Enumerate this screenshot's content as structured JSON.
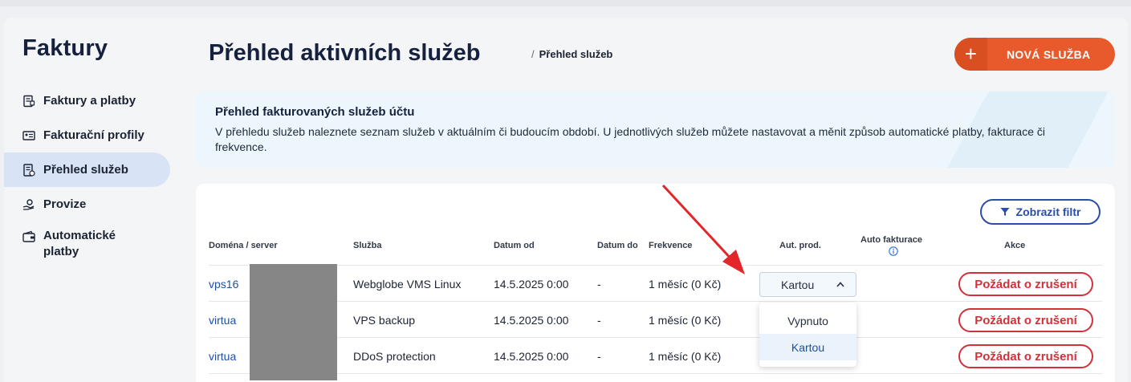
{
  "sidebar": {
    "title": "Faktury",
    "items": [
      {
        "label": "Faktury a platby",
        "icon": "invoice-icon"
      },
      {
        "label": "Fakturační profily",
        "icon": "profile-card-icon"
      },
      {
        "label": "Přehled služeb",
        "icon": "services-doc-icon"
      },
      {
        "label": "Provize",
        "icon": "hand-coin-icon"
      },
      {
        "label": "Automatické platby",
        "icon": "wallet-icon"
      }
    ],
    "active_index": 2
  },
  "header": {
    "title": "Přehled aktivních služeb",
    "breadcrumb_sep": "/",
    "breadcrumb": "Přehled služeb",
    "new_button": "NOVÁ SLUŽBA"
  },
  "info": {
    "title": "Přehled fakturovaných služeb účtu",
    "text": "V přehledu služeb naleznete seznam služeb v aktuálním či budoucím období. U jednotlivých služeb můžete nastavovat a měnit způsob automatické platby, fakturace či frekvence."
  },
  "table": {
    "filter_button": "Zobrazit filtr",
    "headers": {
      "domain": "Doména / server",
      "service": "Služba",
      "date_from": "Datum od",
      "date_to": "Datum do",
      "frequency": "Frekvence",
      "auto_renew": "Aut. prod.",
      "auto_invoice": "Auto fakturace",
      "actions": "Akce"
    },
    "rows": [
      {
        "domain": "vps16",
        "service": "Webglobe VMS Linux",
        "date_from": "14.5.2025 0:00",
        "date_to": "-",
        "frequency": "1 měsíc (0 Kč)",
        "action": "Požádat o zrušení"
      },
      {
        "domain": "virtua",
        "service": "VPS backup",
        "date_from": "14.5.2025 0:00",
        "date_to": "-",
        "frequency": "1 měsíc (0 Kč)",
        "action": "Požádat o zrušení"
      },
      {
        "domain": "virtua",
        "service": "DDoS protection",
        "date_from": "14.5.2025 0:00",
        "date_to": "-",
        "frequency": "1 měsíc (0 Kč)",
        "action": "Požádat o zrušení"
      }
    ],
    "auto_renew_select": {
      "value": "Kartou",
      "options": [
        "Vypnuto",
        "Kartou"
      ],
      "selected_index": 1
    }
  },
  "colors": {
    "accent_orange": "#e85a2c",
    "primary_blue": "#2a4ea8",
    "danger_red": "#d3313a",
    "arrow_red": "#e3262a"
  }
}
